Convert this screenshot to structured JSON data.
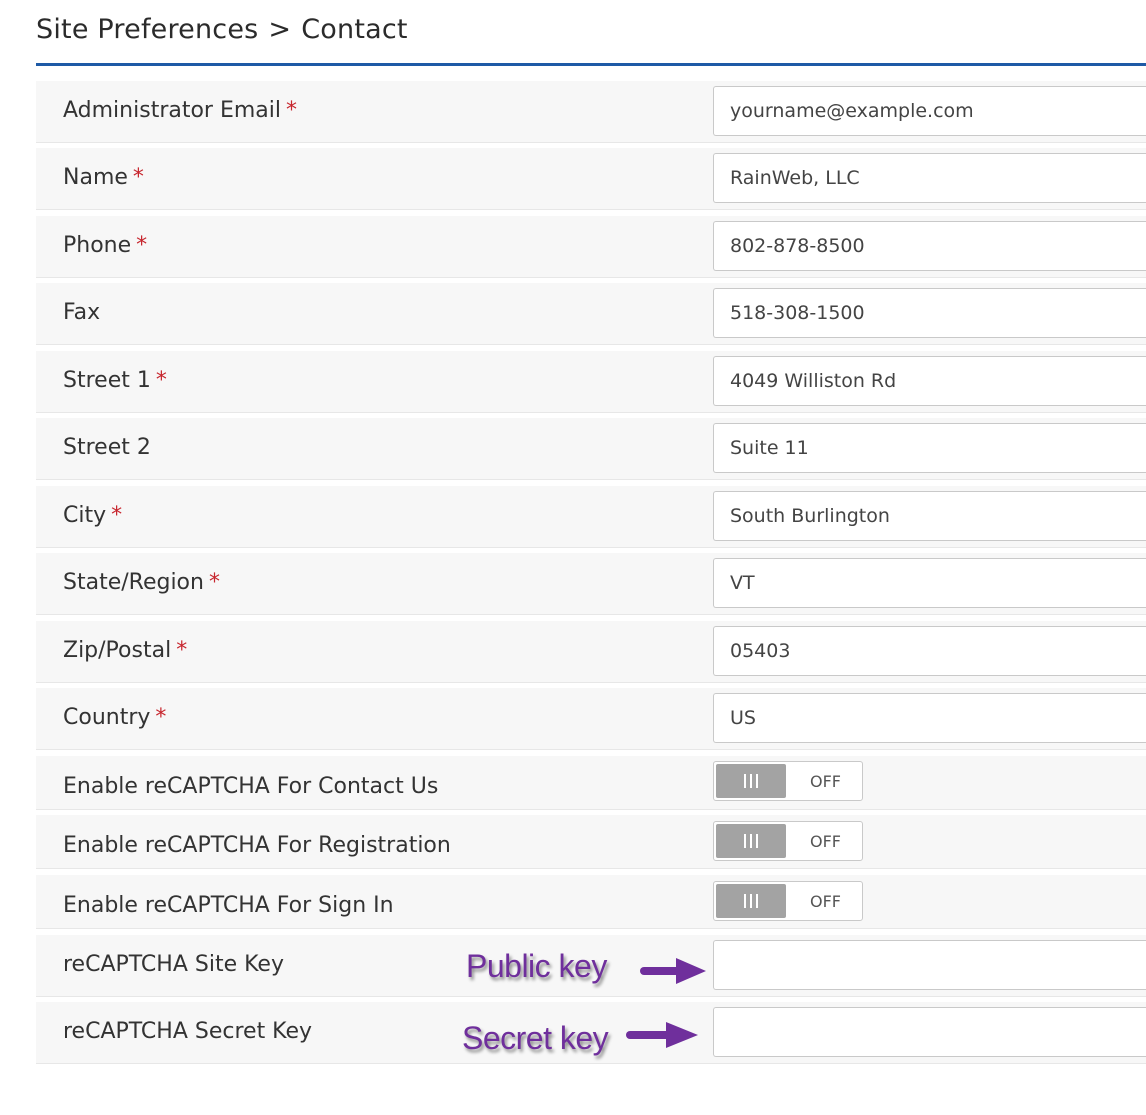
{
  "header": {
    "section": "Site Preferences",
    "separator": ">",
    "page": "Contact"
  },
  "required_marker": "*",
  "fields": [
    {
      "label": "Administrator Email",
      "required": true,
      "value": "yourname@example.com"
    },
    {
      "label": "Name",
      "required": true,
      "value": "RainWeb, LLC"
    },
    {
      "label": "Phone",
      "required": true,
      "value": "802-878-8500"
    },
    {
      "label": "Fax",
      "required": false,
      "value": "518-308-1500"
    },
    {
      "label": "Street 1",
      "required": true,
      "value": "4049 Williston Rd"
    },
    {
      "label": "Street 2",
      "required": false,
      "value": "Suite 11"
    },
    {
      "label": "City",
      "required": true,
      "value": "South Burlington"
    },
    {
      "label": "State/Region",
      "required": true,
      "value": "VT"
    },
    {
      "label": "Zip/Postal",
      "required": true,
      "value": "05403"
    },
    {
      "label": "Country",
      "required": true,
      "value": "US"
    }
  ],
  "toggles": [
    {
      "label": "Enable reCAPTCHA For Contact Us",
      "state": "OFF"
    },
    {
      "label": "Enable reCAPTCHA For Registration",
      "state": "OFF"
    },
    {
      "label": "Enable reCAPTCHA For Sign In",
      "state": "OFF"
    }
  ],
  "keys": [
    {
      "label": "reCAPTCHA Site Key",
      "value": "",
      "annotation": "Public key"
    },
    {
      "label": "reCAPTCHA Secret Key",
      "value": "",
      "annotation": "Secret key"
    }
  ],
  "colors": {
    "accent_rule": "#1e5aa6",
    "required": "#c7262e",
    "annotation": "#6f2f9c",
    "toggle_handle": "#a3a3a3"
  },
  "icons": {
    "toggle_grip": "grip-lines-icon",
    "annotation_arrow": "arrow-right-icon"
  }
}
